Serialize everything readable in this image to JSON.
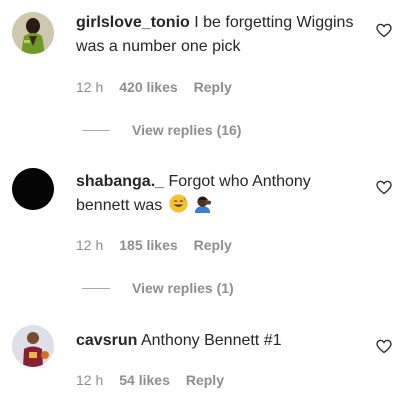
{
  "comments": [
    {
      "username": "girlslove_tonio",
      "text": "I be forgetting Wiggins was a number one pick",
      "time": "12 h",
      "likes": "420 likes",
      "reply": "Reply",
      "view_replies": "View replies (16)",
      "avatar_icon": "person-in-green-jacket-avatar"
    },
    {
      "username": "shabanga._",
      "text": "Forgot who Anthony bennett was",
      "emojis": [
        "grinning-sweat-face-emoji",
        "person-facepalming-emoji"
      ],
      "time": "12 h",
      "likes": "185 likes",
      "reply": "Reply",
      "view_replies": "View replies (1)",
      "avatar_icon": "black-circle-avatar"
    },
    {
      "username": "cavsrun",
      "text": "Anthony Bennett #1",
      "time": "12 h",
      "likes": "54 likes",
      "reply": "Reply",
      "avatar_icon": "basketball-player-avatar"
    }
  ],
  "colors": {
    "text": "#262626",
    "muted": "#8e8e8e",
    "line": "#a8a8a8"
  }
}
